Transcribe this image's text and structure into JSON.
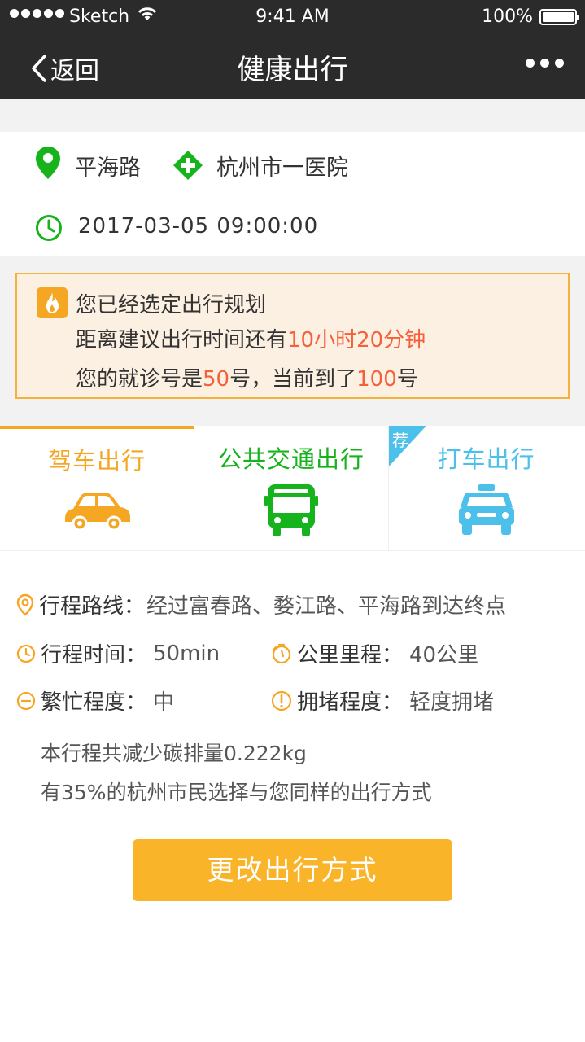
{
  "status_bar": {
    "carrier": "Sketch",
    "time": "9:41 AM",
    "battery": "100%"
  },
  "nav": {
    "back_label": "返回",
    "title": "健康出行"
  },
  "route": {
    "from": "平海路",
    "to": "杭州市一医院"
  },
  "datetime": "2017-03-05   09:00:00",
  "notice": {
    "line1": "您已经选定出行规划",
    "line2_prefix": "距离建议出行时间还有",
    "line2_highlight": "10小时20分钟",
    "line3_prefix": "您的就诊号是",
    "line3_number": "50",
    "line3_mid": "号，当前到了",
    "line3_current": "100",
    "line3_suffix": "号"
  },
  "tabs": [
    {
      "label": "驾车出行",
      "icon": "car-icon",
      "color": "#f5a623",
      "active": true
    },
    {
      "label": "公共交通出行",
      "icon": "bus-icon",
      "color": "#17b31c",
      "active": false
    },
    {
      "label": "打车出行",
      "icon": "taxi-icon",
      "color": "#4cc0ea",
      "active": false,
      "badge": "荐"
    }
  ],
  "details": {
    "route_key": "行程路线：",
    "route_val": "经过富春路、婺江路、平海路到达终点",
    "time_key": "行程时间：",
    "time_val": "50min",
    "distance_key": "公里里程：",
    "distance_val": "40公里",
    "busy_key": "繁忙程度：",
    "busy_val": "中",
    "congestion_key": "拥堵程度：",
    "congestion_val": "轻度拥堵"
  },
  "notes": {
    "carbon": "本行程共减少碳排量0.222kg",
    "share": "有35%的杭州市民选择与您同样的出行方式"
  },
  "button": {
    "change_label": "更改出行方式"
  },
  "colors": {
    "accent": "#f9b42a",
    "highlight": "#f5603b",
    "green": "#17b31c",
    "blue": "#4cc0ea",
    "header": "#2b2b2b"
  }
}
